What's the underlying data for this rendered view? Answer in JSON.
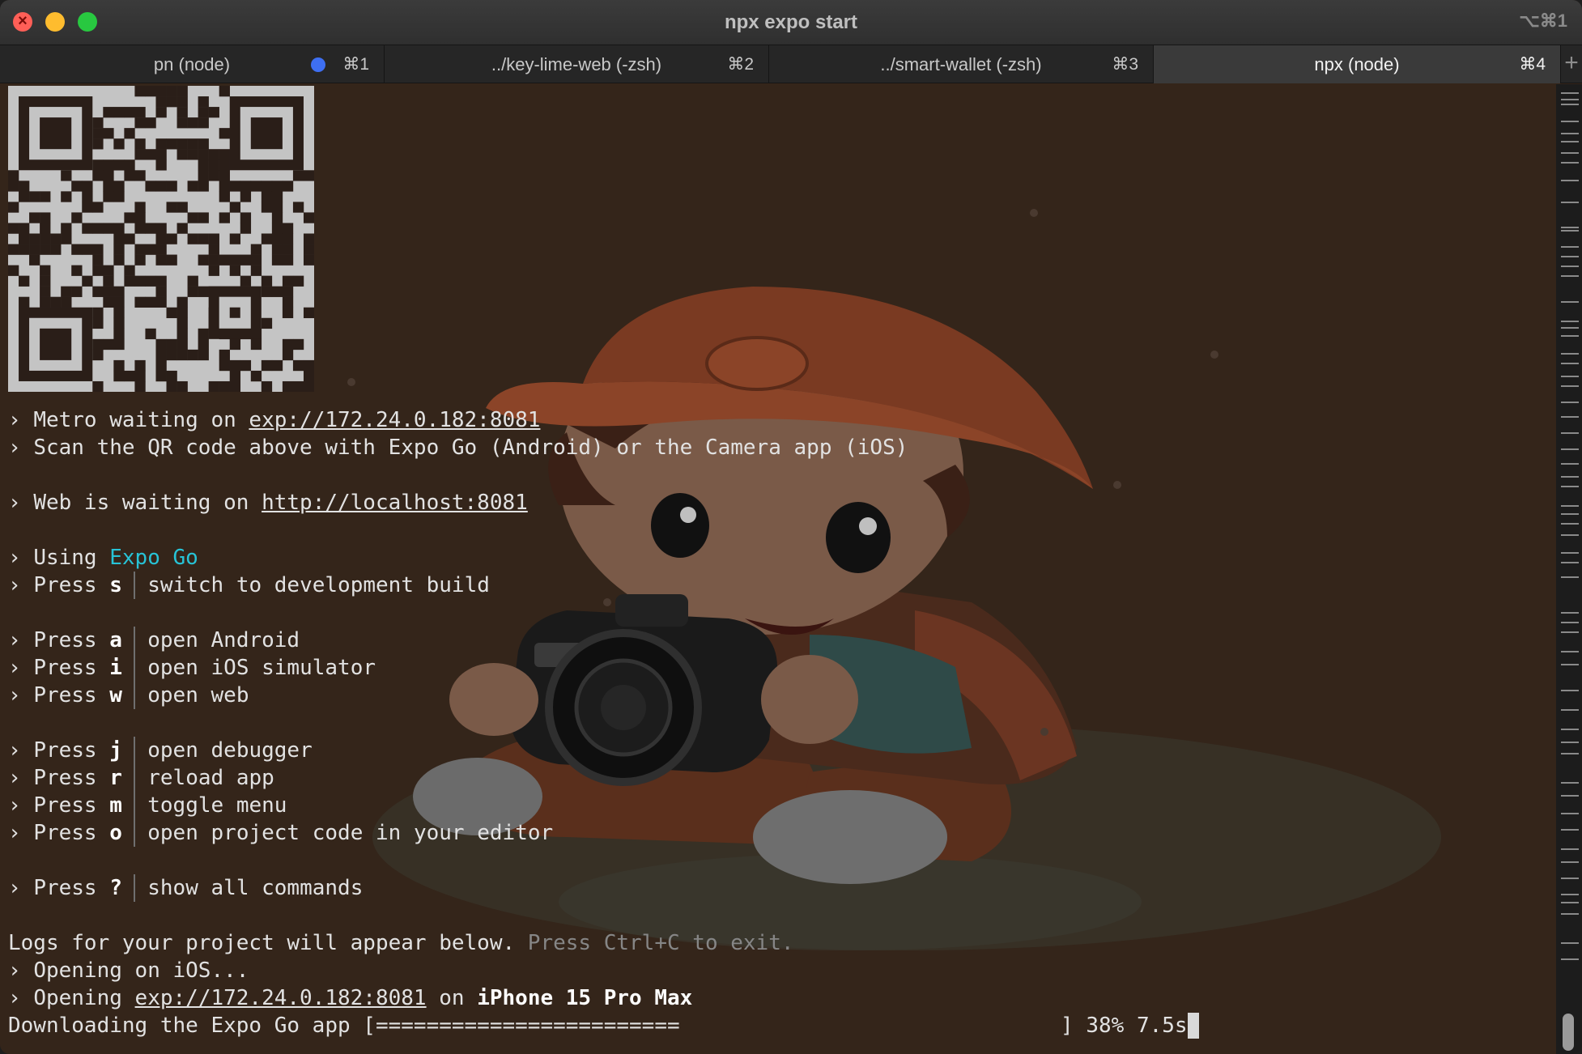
{
  "window": {
    "title": "npx expo start",
    "shortcut": "⌥⌘1"
  },
  "tabs": [
    {
      "title": "pn (node)",
      "key": "⌘1",
      "has_activity_dot": true
    },
    {
      "title": "../key-lime-web (-zsh)",
      "key": "⌘2"
    },
    {
      "title": "../smart-wallet (-zsh)",
      "key": "⌘3"
    },
    {
      "title": "npx (node)",
      "key": "⌘4",
      "active": true
    }
  ],
  "new_tab_label": "+",
  "terminal": {
    "prompt": "›",
    "metro_prefix": "Metro waiting on ",
    "metro_url": "exp://172.24.0.182:8081",
    "scan_text": "Scan the QR code above with Expo Go (Android) or the Camera app (iOS)",
    "web_prefix": "Web is waiting on ",
    "web_url": "http://localhost:8081",
    "using_prefix": "Using ",
    "using_value": "Expo Go",
    "press_label": "Press",
    "commands": [
      {
        "key": "s",
        "desc": "switch to development build"
      },
      {
        "key": "a",
        "desc": "open Android"
      },
      {
        "key": "i",
        "desc": "open iOS simulator"
      },
      {
        "key": "w",
        "desc": "open web"
      },
      {
        "key": "j",
        "desc": "open debugger"
      },
      {
        "key": "r",
        "desc": "reload app"
      },
      {
        "key": "m",
        "desc": "toggle menu"
      },
      {
        "key": "o",
        "desc": "open project code in your editor"
      },
      {
        "key": "?",
        "desc": "show all commands"
      }
    ],
    "logs_text": "Logs for your project will appear below.",
    "logs_hint": "Press Ctrl+C to exit.",
    "opening_ios": "Opening on iOS...",
    "opening_prefix": "Opening ",
    "opening_url": "exp://172.24.0.182:8081",
    "opening_on": " on ",
    "device": "iPhone 15 Pro Max",
    "download_text": "Downloading the Expo Go app [",
    "download_bar": "========================",
    "download_end": "]",
    "download_percent": "38%",
    "download_time": "7.5s",
    "download_progress": 0.38
  },
  "scrollbar": {
    "position": 0.97
  },
  "colors": {
    "terminal_bg": "#34251a",
    "accent_cyan": "#27c3d6",
    "text": "#e2e2e2",
    "tab_dot": "#3e6ff2"
  }
}
